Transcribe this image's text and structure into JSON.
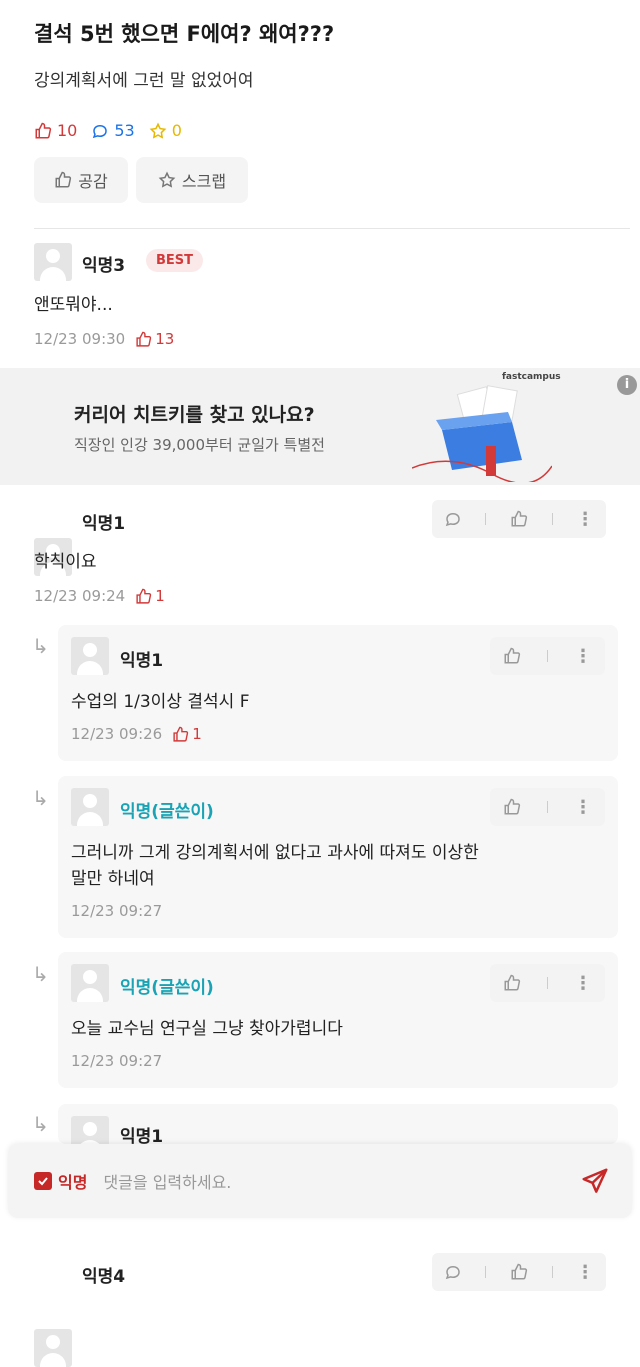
{
  "post": {
    "title": "결석 5번 했으면 F에여? 왜여???",
    "body": "강의계획서에 그런 말 없었어여",
    "likes": "10",
    "comments": "53",
    "scraps": "0",
    "like_button": "공감",
    "scrap_button": "스크랩"
  },
  "best_comment": {
    "nickname": "익명3",
    "badge": "BEST",
    "text": "앤또뭐야...",
    "time": "12/23 09:30",
    "likes": "13"
  },
  "ad": {
    "headline": "커리어 치트키를 찾고 있나요?",
    "sub": "직장인 인강 39,000부터 균일가 특별전",
    "brand": "fastcampus",
    "colors": {
      "box": "#3b7de0",
      "ribbon": "#d23a3a"
    }
  },
  "comments": [
    {
      "nickname": "익명1",
      "text": "학칙이요",
      "time": "12/23 09:24",
      "likes": "1",
      "replies": [
        {
          "nickname": "익명1",
          "text": "수업의 1/3이상 결석시 F",
          "time": "12/23 09:26",
          "likes": "1"
        },
        {
          "nickname": "익명(글쓴이)",
          "text_line1": "그러니까 그게 강의계획서에 없다고 과사에 따져도 이상한",
          "text_line2": "말만 하네여",
          "time": "12/23 09:27"
        },
        {
          "nickname": "익명(글쓴이)",
          "text": "오늘 교수님 연구실 그냥 찾아가렵니다",
          "time": "12/23 09:27"
        },
        {
          "nickname": "익명1"
        }
      ]
    },
    {
      "nickname": "익명4"
    }
  ],
  "composer": {
    "anon_label": "익명",
    "placeholder": "댓글을 입력하세요."
  },
  "colors": {
    "accent": "#d23a3a",
    "op_name": "#1aa3b4",
    "comment_icon": "#1a73e8",
    "scrap_star": "#e6b800"
  }
}
